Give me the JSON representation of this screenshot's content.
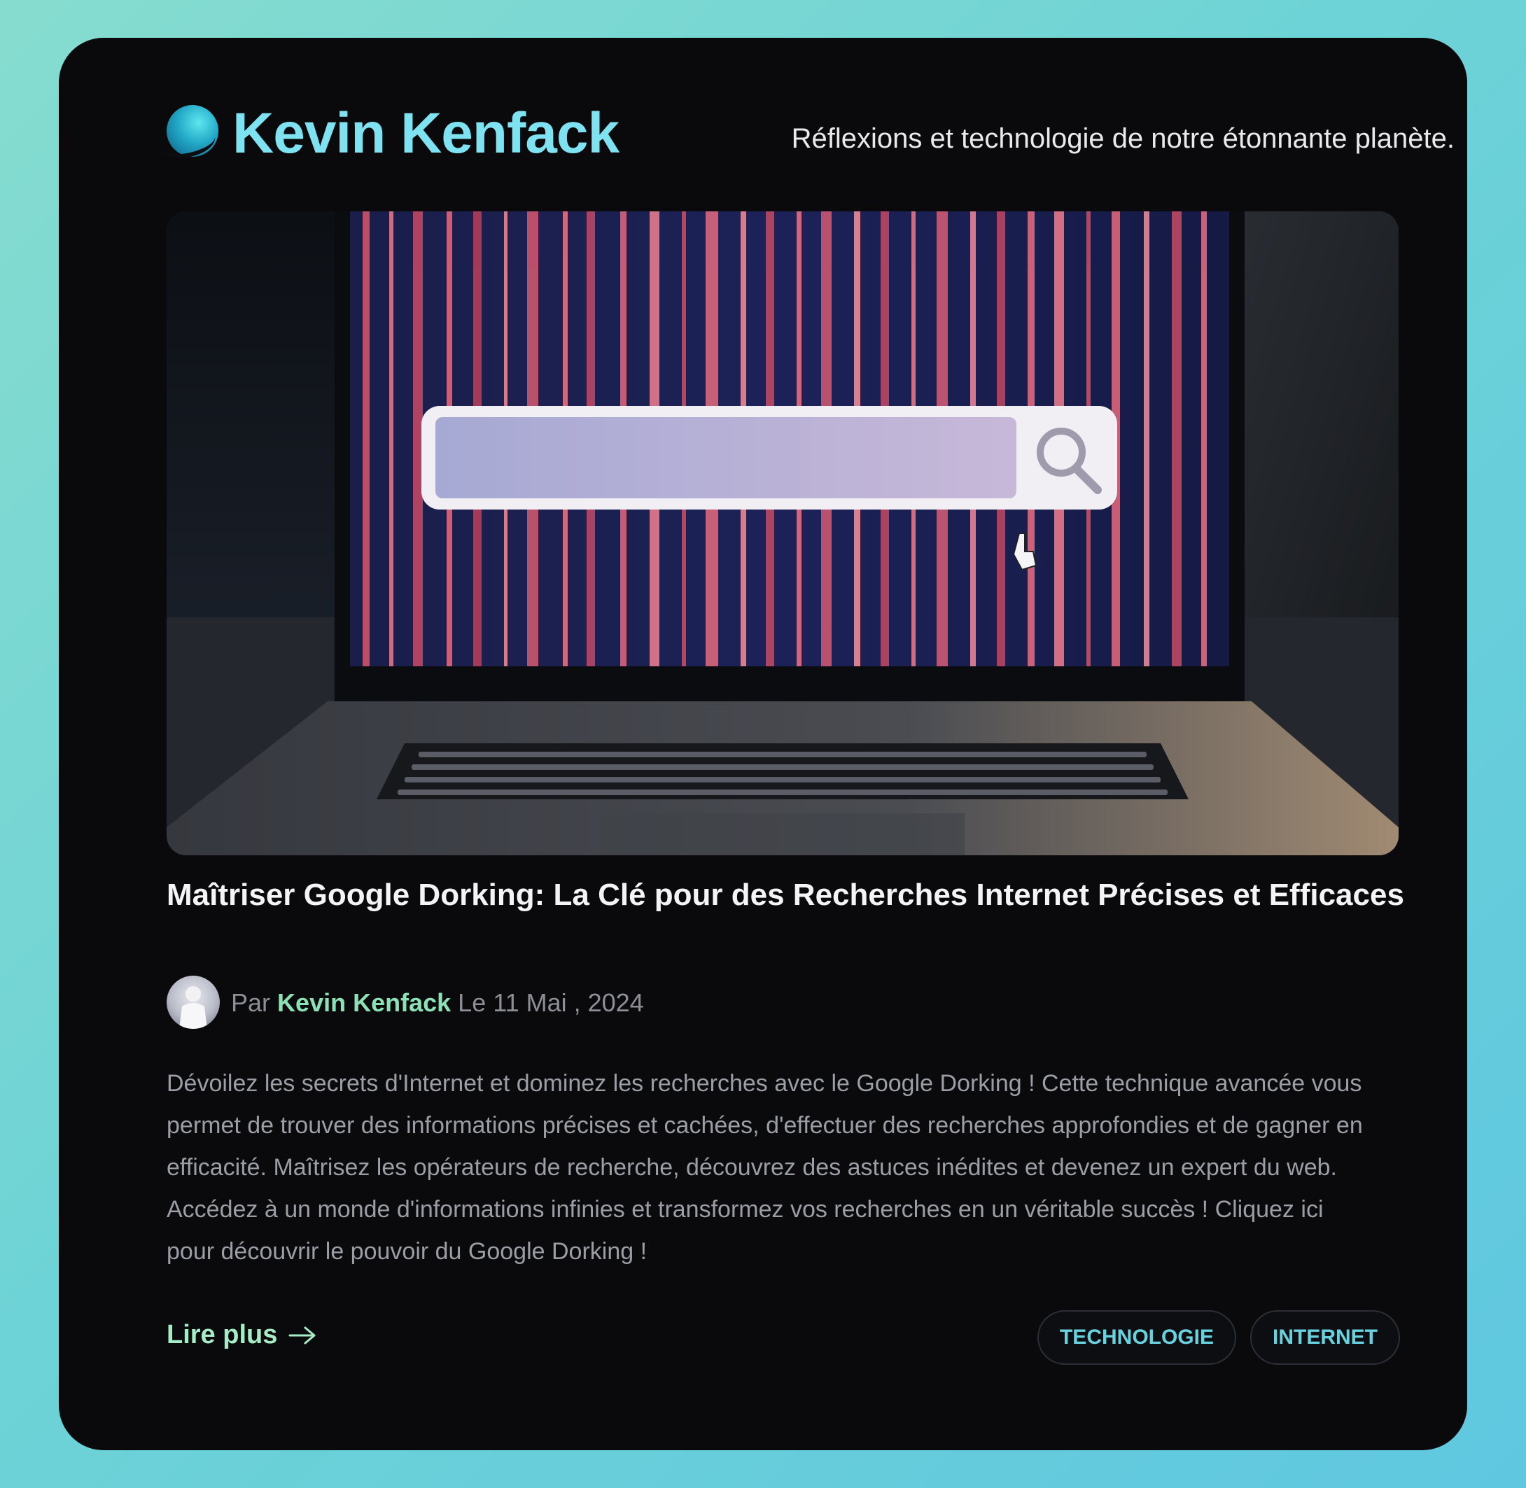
{
  "header": {
    "site_title": "Kevin Kenfack",
    "tagline": "Réflexions et technologie de notre étonnante planète.",
    "logo_icon": "globe-logo-icon"
  },
  "post": {
    "hero_image": "laptop-search-bar-image",
    "title": "Maîtriser Google Dorking: La Clé pour des Recherches Internet Précises et Efficaces",
    "byline_prefix": "Par",
    "author": "Kevin Kenfack",
    "date": "Le 11 Mai , 2024",
    "excerpt": "Dévoilez les secrets d'Internet et dominez les recherches avec le Google Dorking ! Cette technique avancée vous permet de trouver des informations précises et cachées, d'effectuer des recherches approfondies et de gagner en efficacité. Maîtrisez les opérateurs de recherche, découvrez des astuces inédites et devenez un expert du web. Accédez à un monde d'informations infinies et transformez vos recherches en un véritable succès ! Cliquez ici pour découvrir le pouvoir du Google Dorking !",
    "read_more": "Lire plus",
    "tags": [
      "TECHNOLOGIE",
      "INTERNET"
    ]
  },
  "colors": {
    "background_gradient": [
      "#86dccf",
      "#5fc7e0"
    ],
    "card": "#0a0a0c",
    "title_accent": "#7fe2f0",
    "author_accent": "#8ce1b6",
    "tag_text": "#69d2df"
  }
}
